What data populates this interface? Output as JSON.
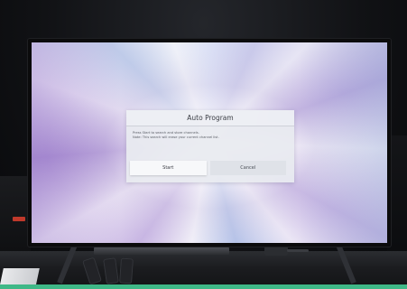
{
  "dialog": {
    "title": "Auto Program",
    "message_line1": "Press Start to search and store channels.",
    "message_line2": "Note: This search will erase your current channel list.",
    "buttons": {
      "start": "Start",
      "cancel": "Cancel"
    },
    "focused_button": "Start"
  },
  "colors": {
    "dialog_bg": "#e8ebf0",
    "focused_button_bg": "#f7f8fa",
    "screen_tint": "#c4b2e2",
    "bottom_strip": "#3fb887",
    "status_led": "#c0392b"
  }
}
